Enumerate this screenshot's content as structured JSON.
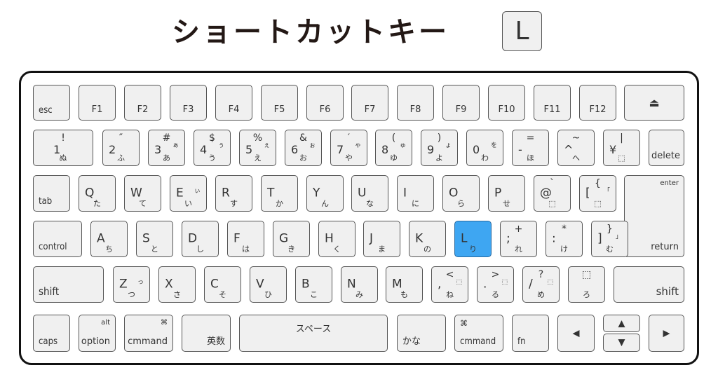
{
  "title": "ショートカットキー",
  "highlight_key": "L",
  "accent_color": "#3ea6f2",
  "rows": {
    "fn_row": [
      {
        "id": "esc",
        "label": "esc"
      },
      {
        "id": "f1",
        "label": "F1"
      },
      {
        "id": "f2",
        "label": "F2"
      },
      {
        "id": "f3",
        "label": "F3"
      },
      {
        "id": "f4",
        "label": "F4"
      },
      {
        "id": "f5",
        "label": "F5"
      },
      {
        "id": "f6",
        "label": "F6"
      },
      {
        "id": "f7",
        "label": "F7"
      },
      {
        "id": "f8",
        "label": "F8"
      },
      {
        "id": "f9",
        "label": "F9"
      },
      {
        "id": "f10",
        "label": "F10"
      },
      {
        "id": "f11",
        "label": "F11"
      },
      {
        "id": "f12",
        "label": "F12"
      },
      {
        "id": "eject",
        "label": "⏏"
      }
    ],
    "number_row": [
      {
        "id": "1",
        "main": "1",
        "sym": "!",
        "kana": "ぬ",
        "kana2": ""
      },
      {
        "id": "2",
        "main": "2",
        "sym": "″",
        "kana": "ふ",
        "kana2": ""
      },
      {
        "id": "3",
        "main": "3",
        "sym": "#",
        "kana": "あ",
        "kana2": "ぁ"
      },
      {
        "id": "4",
        "main": "4",
        "sym": "$",
        "kana": "う",
        "kana2": "ぅ"
      },
      {
        "id": "5",
        "main": "5",
        "sym": "%",
        "kana": "え",
        "kana2": "ぇ"
      },
      {
        "id": "6",
        "main": "6",
        "sym": "&",
        "kana": "お",
        "kana2": "ぉ"
      },
      {
        "id": "7",
        "main": "7",
        "sym": "′",
        "kana": "や",
        "kana2": "ゃ"
      },
      {
        "id": "8",
        "main": "8",
        "sym": "(",
        "kana": "ゆ",
        "kana2": "ゅ"
      },
      {
        "id": "9",
        "main": "9",
        "sym": ")",
        "kana": "よ",
        "kana2": "ょ"
      },
      {
        "id": "0",
        "main": "0",
        "sym": "",
        "kana": "わ",
        "kana2": "を"
      },
      {
        "id": "minus",
        "main": "-",
        "sym": "=",
        "kana": "ほ",
        "kana2": ""
      },
      {
        "id": "caret",
        "main": "^",
        "sym": "~",
        "kana": "へ",
        "kana2": ""
      },
      {
        "id": "yen",
        "main": "¥",
        "sym": "|",
        "kana": "⬚",
        "kana2": ""
      },
      {
        "id": "delete",
        "label": "delete"
      }
    ],
    "top_row": [
      {
        "id": "tab",
        "label": "tab"
      },
      {
        "id": "q",
        "main": "Q",
        "kana": "た",
        "kana2": ""
      },
      {
        "id": "w",
        "main": "W",
        "kana": "て",
        "kana2": ""
      },
      {
        "id": "e",
        "main": "E",
        "kana": "い",
        "kana2": "ぃ"
      },
      {
        "id": "r",
        "main": "R",
        "kana": "す",
        "kana2": ""
      },
      {
        "id": "t",
        "main": "T",
        "kana": "か",
        "kana2": ""
      },
      {
        "id": "y",
        "main": "Y",
        "kana": "ん",
        "kana2": ""
      },
      {
        "id": "u",
        "main": "U",
        "kana": "な",
        "kana2": ""
      },
      {
        "id": "i",
        "main": "I",
        "kana": "に",
        "kana2": ""
      },
      {
        "id": "o",
        "main": "O",
        "kana": "ら",
        "kana2": ""
      },
      {
        "id": "p",
        "main": "P",
        "kana": "せ",
        "kana2": ""
      },
      {
        "id": "at",
        "main": "@",
        "sym": "`",
        "kana": "⬚",
        "kana2": ""
      },
      {
        "id": "lbracket",
        "main": "[",
        "sym": "{",
        "kana": "⬚",
        "kana2": "「"
      },
      {
        "id": "enter",
        "label_top": "enter",
        "label_bottom": "return"
      }
    ],
    "home_row": [
      {
        "id": "control",
        "label": "control"
      },
      {
        "id": "a",
        "main": "A",
        "kana": "ち"
      },
      {
        "id": "s",
        "main": "S",
        "kana": "と"
      },
      {
        "id": "d",
        "main": "D",
        "kana": "し"
      },
      {
        "id": "f",
        "main": "F",
        "kana": "は"
      },
      {
        "id": "g",
        "main": "G",
        "kana": "き"
      },
      {
        "id": "h",
        "main": "H",
        "kana": "く"
      },
      {
        "id": "j",
        "main": "J",
        "kana": "ま"
      },
      {
        "id": "k",
        "main": "K",
        "kana": "の"
      },
      {
        "id": "l",
        "main": "L",
        "kana": "り"
      },
      {
        "id": "semicolon",
        "main": ";",
        "sym": "+",
        "kana": "れ"
      },
      {
        "id": "colon",
        "main": ":",
        "sym": "*",
        "kana": "け"
      },
      {
        "id": "rbracket",
        "main": "]",
        "sym": "}",
        "kana": "む",
        "kana2": "」"
      }
    ],
    "shift_row": [
      {
        "id": "shift_l",
        "label": "shift"
      },
      {
        "id": "z",
        "main": "Z",
        "kana": "つ",
        "kana2": "っ"
      },
      {
        "id": "x",
        "main": "X",
        "kana": "さ"
      },
      {
        "id": "c",
        "main": "C",
        "kana": "そ"
      },
      {
        "id": "v",
        "main": "V",
        "kana": "ひ"
      },
      {
        "id": "b",
        "main": "B",
        "kana": "こ"
      },
      {
        "id": "n",
        "main": "N",
        "kana": "み"
      },
      {
        "id": "m",
        "main": "M",
        "kana": "も"
      },
      {
        "id": "comma",
        "main": ",",
        "sym": "<",
        "kana": "ね",
        "kana2": "⬚"
      },
      {
        "id": "period",
        "main": ".",
        "sym": ">",
        "kana": "る",
        "kana2": "⬚"
      },
      {
        "id": "slash",
        "main": "/",
        "sym": "?",
        "kana": "め",
        "kana2": "⬚"
      },
      {
        "id": "underscore",
        "main": "",
        "sym": "⬚",
        "kana": "ろ"
      },
      {
        "id": "shift_r",
        "label": "shift"
      }
    ],
    "bottom_row": [
      {
        "id": "caps",
        "label": "caps"
      },
      {
        "id": "option",
        "label_top": "alt",
        "label_bottom": "option"
      },
      {
        "id": "command_l",
        "label_top": "⌘",
        "label_bottom": "cmmand"
      },
      {
        "id": "eisu",
        "label": "英数"
      },
      {
        "id": "space",
        "label": "スペース"
      },
      {
        "id": "kana",
        "label": "かな"
      },
      {
        "id": "command_r",
        "label_top": "⌘",
        "label_bottom": "cmmand"
      },
      {
        "id": "fn",
        "label": "fn"
      },
      {
        "id": "left",
        "label": "◀"
      },
      {
        "id": "up",
        "label": "▲"
      },
      {
        "id": "down",
        "label": "▼"
      },
      {
        "id": "right",
        "label": "▶"
      }
    ]
  }
}
